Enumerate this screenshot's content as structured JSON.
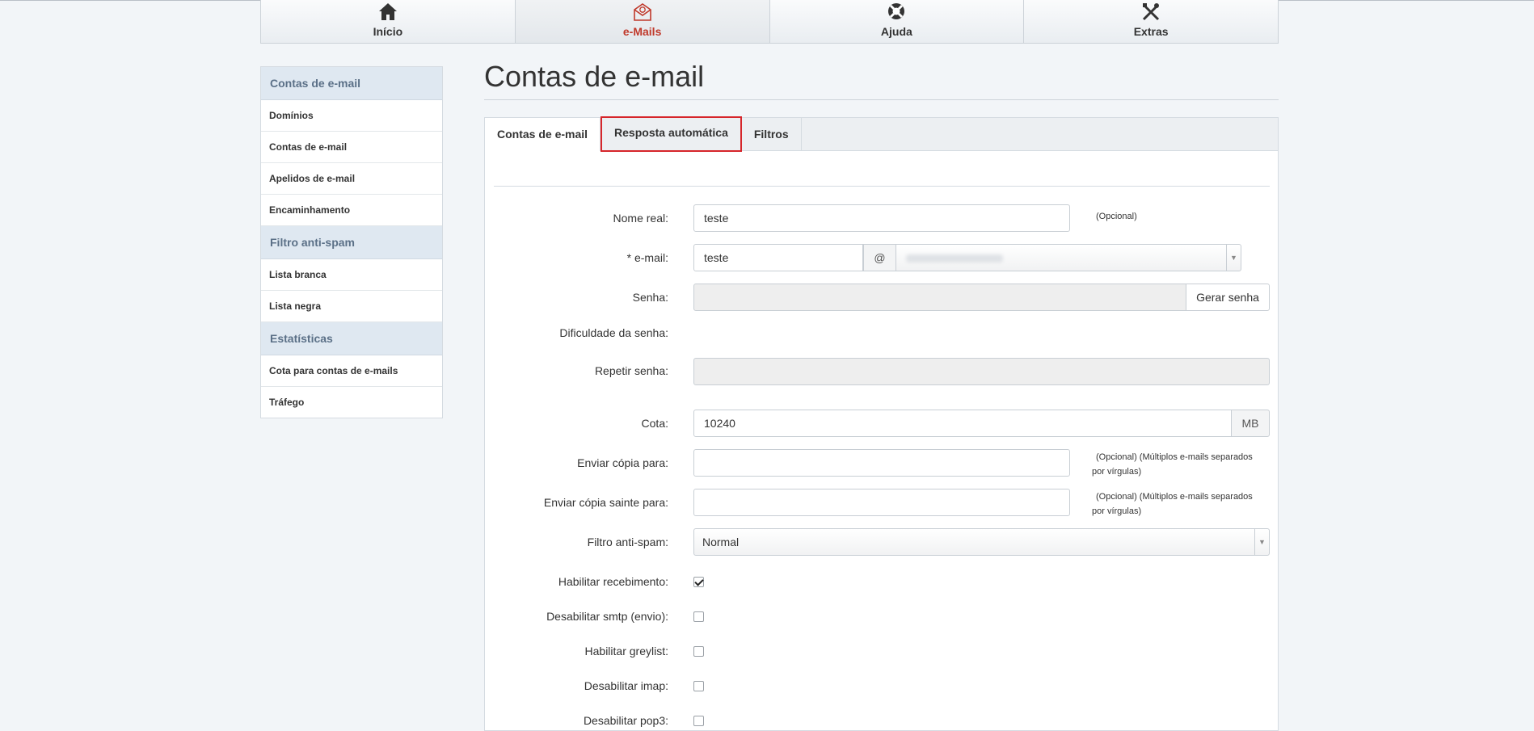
{
  "topnav": {
    "items": [
      {
        "label": "Início",
        "icon": "home-icon"
      },
      {
        "label": "e-Mails",
        "icon": "envelope-at-icon"
      },
      {
        "label": "Ajuda",
        "icon": "lifebuoy-icon"
      },
      {
        "label": "Extras",
        "icon": "tools-icon"
      }
    ],
    "active": "e-Mails",
    "accent_color": "#c0392b"
  },
  "sidebar": {
    "sections": [
      {
        "header": "Contas de e-mail",
        "items": [
          "Domínios",
          "Contas de e-mail",
          "Apelidos de e-mail",
          "Encaminhamento"
        ]
      },
      {
        "header": "Filtro anti-spam",
        "items": [
          "Lista branca",
          "Lista negra"
        ]
      },
      {
        "header": "Estatísticas",
        "items": [
          "Cota para contas de e-mails",
          "Tráfego"
        ]
      }
    ]
  },
  "page": {
    "title": "Contas de e-mail",
    "tabs": [
      "Contas de e-mail",
      "Resposta automática",
      "Filtros"
    ],
    "active_tab": "Contas de e-mail",
    "highlighted_tab": "Resposta automática"
  },
  "form": {
    "nome_real": {
      "label": "Nome real:",
      "value": "teste",
      "hint": "(Opcional)"
    },
    "email": {
      "label": "* e-mail:",
      "value": "teste",
      "at": "@"
    },
    "senha": {
      "label": "Senha:",
      "button": "Gerar senha"
    },
    "dificuldade": {
      "label": "Dificuldade da senha:"
    },
    "repetir_senha": {
      "label": "Repetir senha:"
    },
    "cota": {
      "label": "Cota:",
      "value": "10240",
      "unit": "MB"
    },
    "copia": {
      "label": "Enviar cópia para:",
      "hint1": "(Opcional) (Múltiplos e-mails separados",
      "hint2": "por vírgulas)"
    },
    "copia_sainte": {
      "label": "Enviar cópia sainte para:",
      "hint1": "(Opcional) (Múltiplos e-mails separados",
      "hint2": "por vírgulas)"
    },
    "filtro": {
      "label": "Filtro anti-spam:",
      "value": "Normal"
    },
    "checkboxes": [
      {
        "label": "Habilitar recebimento:",
        "checked": true
      },
      {
        "label": "Desabilitar smtp (envio):",
        "checked": false
      },
      {
        "label": "Habilitar greylist:",
        "checked": false
      },
      {
        "label": "Desabilitar imap:",
        "checked": false
      }
    ],
    "partial_label": "Desabilitar pop3:"
  }
}
